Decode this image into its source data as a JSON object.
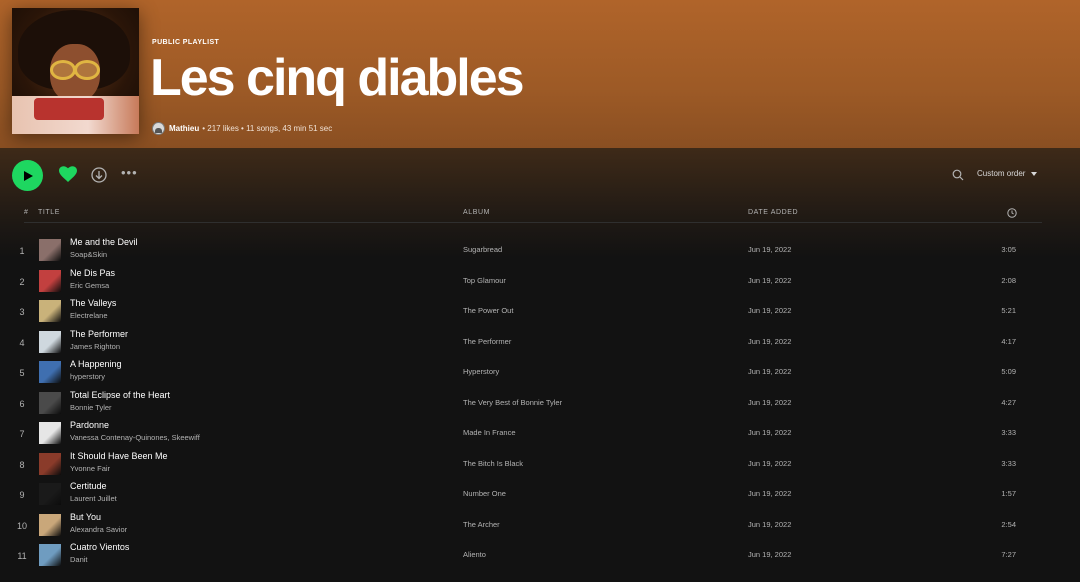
{
  "playlist": {
    "type_label": "PUBLIC PLAYLIST",
    "title": "Les cinq diables",
    "owner": "Mathieu",
    "details": "• 217 likes • 11 songs, 43 min 51 sec"
  },
  "toolbar": {
    "sort_label": "Custom order"
  },
  "columns": {
    "number": "#",
    "title": "TITLE",
    "album": "ALBUM",
    "date_added": "DATE ADDED"
  },
  "colors": {
    "accent": "#1ed760",
    "header": "#b0642a",
    "background": "#121212"
  },
  "tracks": [
    {
      "num": "1",
      "title": "Me and the Devil",
      "artist": "Soap&Skin",
      "album": "Sugarbread",
      "date": "Jun 19, 2022",
      "duration": "3:05",
      "thumb": "#8a6f6a"
    },
    {
      "num": "2",
      "title": "Ne Dis Pas",
      "artist": "Eric Gemsa",
      "album": "Top Glamour",
      "date": "Jun 19, 2022",
      "duration": "2:08",
      "thumb": "#c2403f"
    },
    {
      "num": "3",
      "title": "The Valleys",
      "artist": "Electrelane",
      "album": "The Power Out",
      "date": "Jun 19, 2022",
      "duration": "5:21",
      "thumb": "#c9b27a"
    },
    {
      "num": "4",
      "title": "The Performer",
      "artist": "James Righton",
      "album": "The Performer",
      "date": "Jun 19, 2022",
      "duration": "4:17",
      "thumb": "#cfd8de"
    },
    {
      "num": "5",
      "title": "A Happening",
      "artist": "hyperstory",
      "album": "Hyperstory",
      "date": "Jun 19, 2022",
      "duration": "5:09",
      "thumb": "#3f6fb0"
    },
    {
      "num": "6",
      "title": "Total Eclipse of the Heart",
      "artist": "Bonnie Tyler",
      "album": "The Very Best of Bonnie Tyler",
      "date": "Jun 19, 2022",
      "duration": "4:27",
      "thumb": "#4a4a4a"
    },
    {
      "num": "7",
      "title": "Pardonne",
      "artist": "Vanessa Contenay-Quinones, Skeewiff",
      "album": "Made In France",
      "date": "Jun 19, 2022",
      "duration": "3:33",
      "thumb": "#e6e6e6"
    },
    {
      "num": "8",
      "title": "It Should Have Been Me",
      "artist": "Yvonne Fair",
      "album": "The Bitch Is Black",
      "date": "Jun 19, 2022",
      "duration": "3:33",
      "thumb": "#8a3b2a"
    },
    {
      "num": "9",
      "title": "Certitude",
      "artist": "Laurent Juillet",
      "album": "Number One",
      "date": "Jun 19, 2022",
      "duration": "1:57",
      "thumb": "#1a1a1a"
    },
    {
      "num": "10",
      "title": "But You",
      "artist": "Alexandra Savior",
      "album": "The Archer",
      "date": "Jun 19, 2022",
      "duration": "2:54",
      "thumb": "#c9a77a"
    },
    {
      "num": "11",
      "title": "Cuatro Vientos",
      "artist": "Danit",
      "album": "Aliento",
      "date": "Jun 19, 2022",
      "duration": "7:27",
      "thumb": "#6f9cc0"
    }
  ]
}
